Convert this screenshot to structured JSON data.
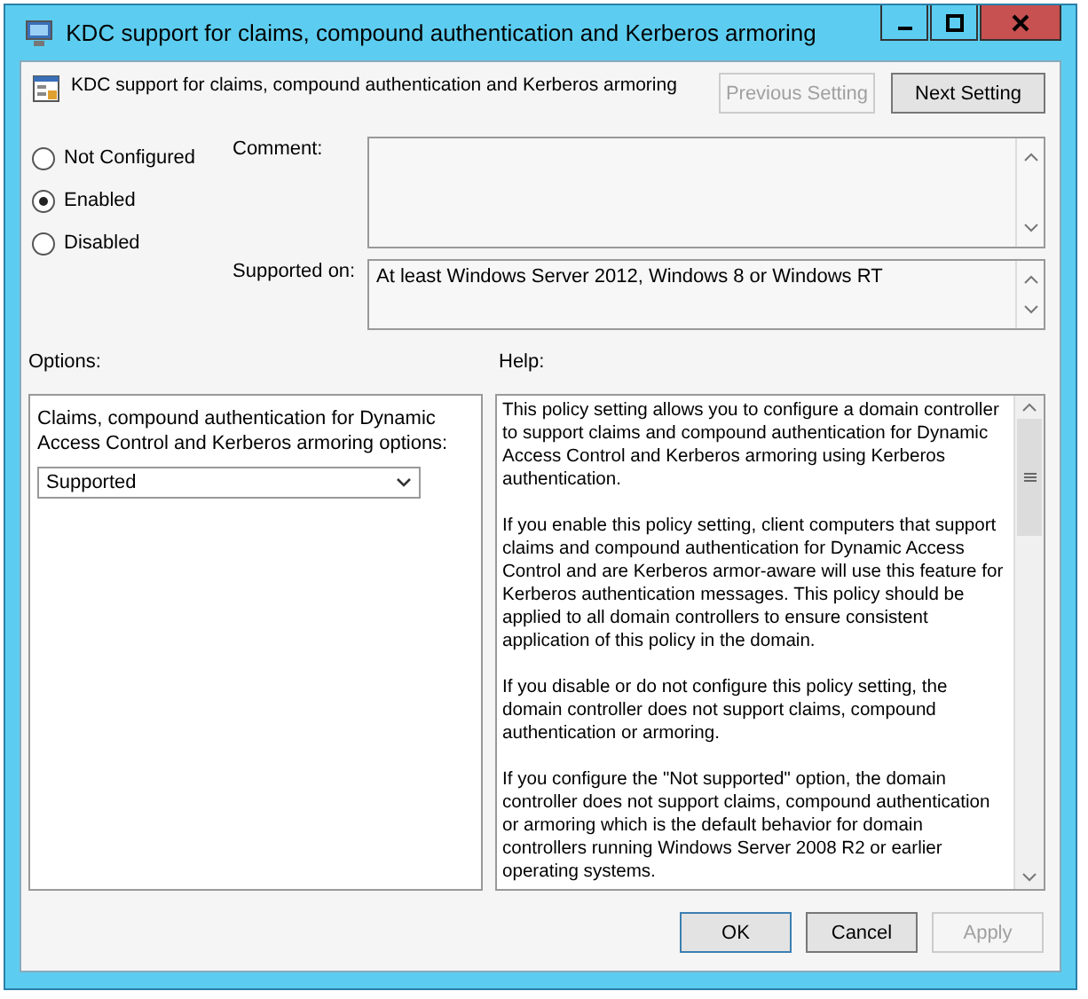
{
  "window": {
    "title": "KDC support for claims, compound authentication and Kerberos armoring"
  },
  "header": {
    "title": "KDC support for claims, compound authentication and Kerberos armoring"
  },
  "nav_buttons": [
    {
      "label": "Previous Setting",
      "disabled": true
    },
    {
      "label": "Next Setting",
      "disabled": false
    }
  ],
  "state_options": [
    {
      "label": "Not Configured",
      "selected": false
    },
    {
      "label": "Enabled",
      "selected": true
    },
    {
      "label": "Disabled",
      "selected": false
    }
  ],
  "comment": {
    "label": "Comment:"
  },
  "supported_on": {
    "label": "Supported on:",
    "value": "At least Windows Server 2012, Windows 8 or Windows RT"
  },
  "options": {
    "label": "Options:",
    "field_label": "Claims, compound authentication for Dynamic Access Control and Kerberos armoring options:",
    "dropdown_value": "Supported"
  },
  "help": {
    "label": "Help:",
    "paragraphs": [
      "This policy setting allows you to configure a domain controller to support claims and compound authentication for Dynamic Access Control and Kerberos armoring using Kerberos authentication.",
      "If you enable this policy setting, client computers that support claims and compound authentication for Dynamic Access Control and are Kerberos armor-aware will use this feature for Kerberos authentication messages. This policy should be applied to all domain controllers to ensure consistent application of this policy in the domain.",
      "If you disable or do not configure this policy setting, the domain controller does not support claims, compound authentication or armoring.",
      "If you configure the \"Not supported\" option, the domain controller does not support claims, compound authentication or armoring which is the default behavior for domain controllers running Windows Server 2008 R2 or earlier operating systems."
    ]
  },
  "buttons": [
    {
      "label": "OK",
      "disabled": false
    },
    {
      "label": "Cancel",
      "disabled": false
    },
    {
      "label": "Apply",
      "disabled": true
    }
  ]
}
